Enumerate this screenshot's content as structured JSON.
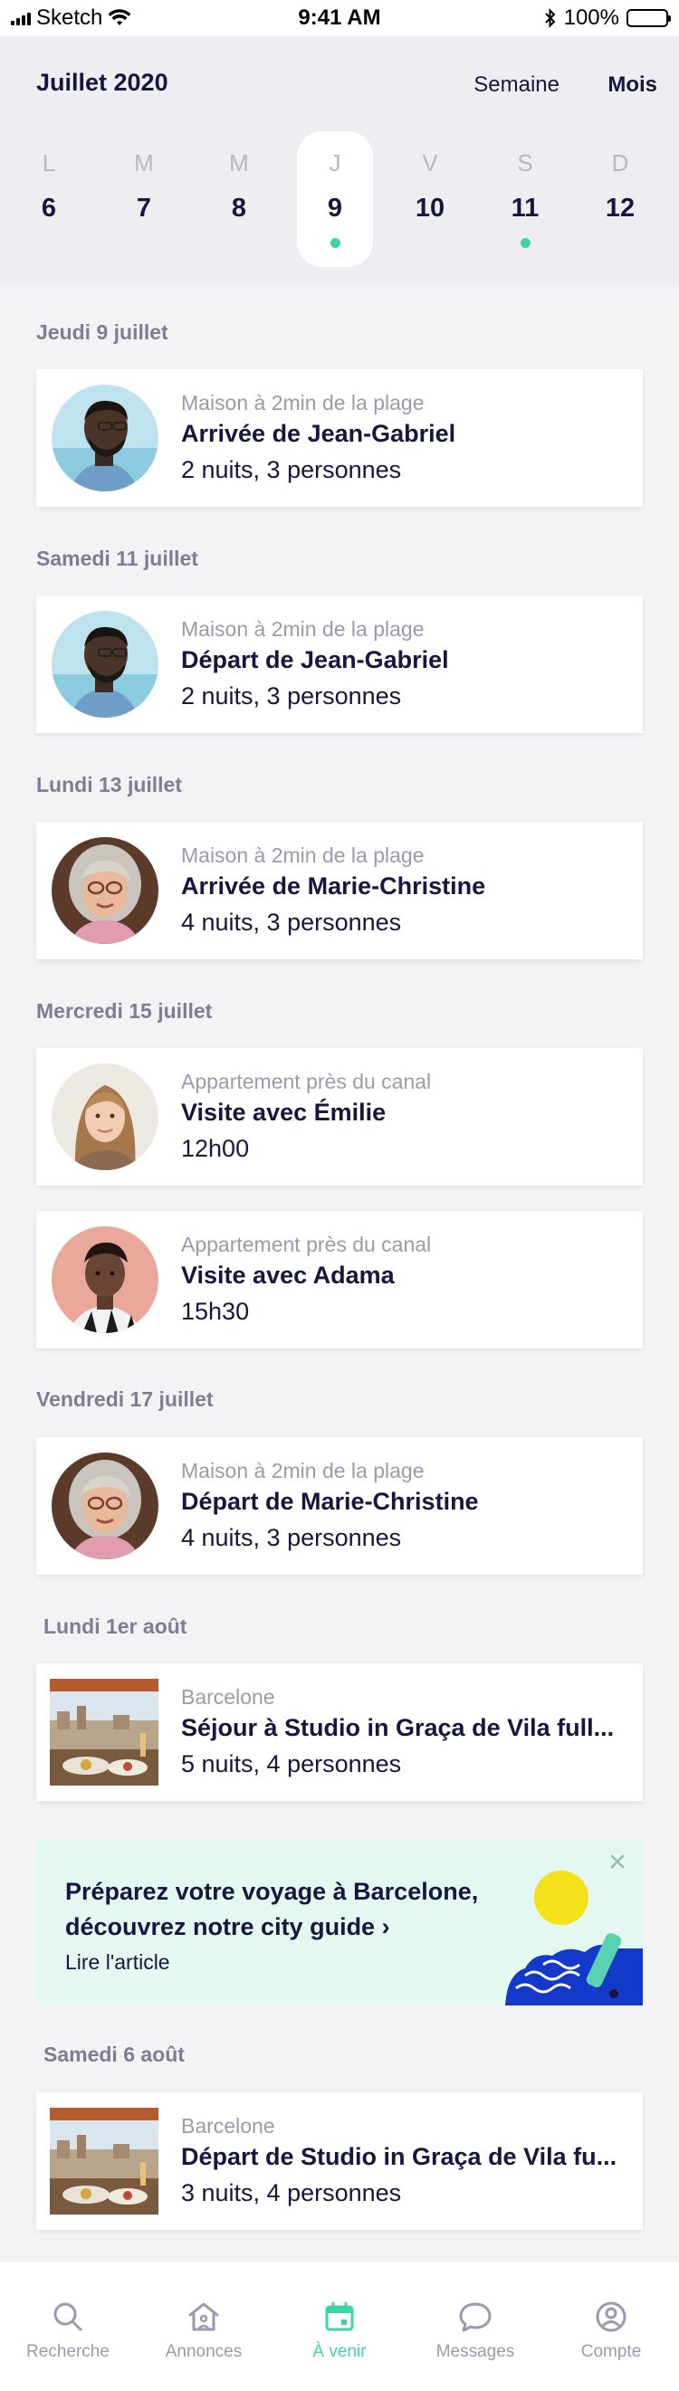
{
  "status_bar": {
    "carrier": "Sketch",
    "time": "9:41 AM",
    "battery": "100%"
  },
  "calendar": {
    "month_title": "Juillet 2020",
    "view_week": "Semaine",
    "view_month": "Mois",
    "days": [
      {
        "letter": "L",
        "number": "6",
        "selected": false,
        "has_event": false
      },
      {
        "letter": "M",
        "number": "7",
        "selected": false,
        "has_event": false
      },
      {
        "letter": "M",
        "number": "8",
        "selected": false,
        "has_event": false
      },
      {
        "letter": "J",
        "number": "9",
        "selected": true,
        "has_event": true
      },
      {
        "letter": "V",
        "number": "10",
        "selected": false,
        "has_event": false
      },
      {
        "letter": "S",
        "number": "11",
        "selected": false,
        "has_event": true
      },
      {
        "letter": "D",
        "number": "12",
        "selected": false,
        "has_event": false
      }
    ]
  },
  "agenda": {
    "sections": [
      {
        "date": "Jeudi 9 juillet",
        "events": [
          {
            "location": "Maison à 2min de la plage",
            "title": "Arrivée de Jean-Gabriel",
            "detail": "2 nuits, 3 personnes",
            "avatar": "man-glasses"
          }
        ]
      },
      {
        "date": "Samedi 11 juillet",
        "events": [
          {
            "location": "Maison à 2min de la plage",
            "title": "Départ de Jean-Gabriel",
            "detail": "2 nuits, 3 personnes",
            "avatar": "man-glasses"
          }
        ]
      },
      {
        "date": "Lundi 13 juillet",
        "events": [
          {
            "location": "Maison à 2min de la plage",
            "title": "Arrivée de Marie-Christine",
            "detail": "4 nuits, 3 personnes",
            "avatar": "woman-grey-hair"
          }
        ]
      },
      {
        "date": "Mercredi 15 juillet",
        "events": [
          {
            "location": "Appartement près du canal",
            "title": "Visite avec Émilie",
            "detail": "12h00",
            "avatar": "young-woman"
          },
          {
            "location": "Appartement près du canal",
            "title": "Visite avec Adama",
            "detail": "15h30",
            "avatar": "young-man"
          }
        ]
      },
      {
        "date": "Vendredi 17 juillet",
        "events": [
          {
            "location": "Maison à 2min de la plage",
            "title": "Départ de Marie-Christine",
            "detail": "4 nuits, 3 personnes",
            "avatar": "woman-grey-hair"
          }
        ]
      },
      {
        "date": "Lundi 1er août",
        "events": [
          {
            "location": "Barcelone",
            "title": "Séjour à Studio in Graça de Vila full...",
            "detail": "5 nuits, 4 personnes",
            "avatar": "barcelona-terrace"
          }
        ]
      },
      {
        "date": "Samedi 6 août",
        "events": [
          {
            "location": "Barcelone",
            "title": "Départ de Studio in Graça de Vila fu...",
            "detail": "3 nuits, 4 personnes",
            "avatar": "barcelona-terrace"
          }
        ]
      }
    ]
  },
  "promo": {
    "title": "Préparez votre voyage à Barcelone, découvrez notre city guide ›",
    "link": "Lire l'article"
  },
  "bottom_nav": {
    "items": [
      {
        "label": "Recherche",
        "icon": "search-icon",
        "active": false
      },
      {
        "label": "Annonces",
        "icon": "home-icon",
        "active": false
      },
      {
        "label": "À venir",
        "icon": "calendar-icon",
        "active": true
      },
      {
        "label": "Messages",
        "icon": "chat-icon",
        "active": false
      },
      {
        "label": "Compte",
        "icon": "account-icon",
        "active": false
      }
    ]
  },
  "colors": {
    "accent": "#3fd4a8",
    "text": "#16163f",
    "muted": "#9a9aae",
    "header_bg": "#eeeef2",
    "promo_bg": "#e3f8f1"
  }
}
